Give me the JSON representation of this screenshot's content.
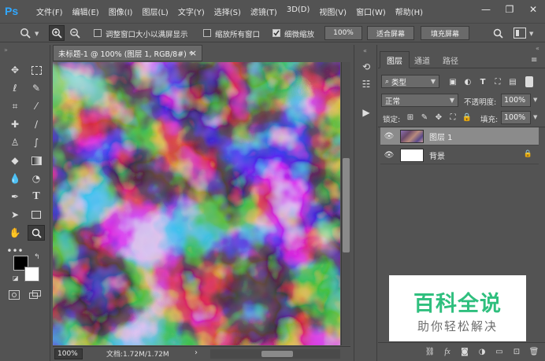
{
  "app": {
    "logo": "Ps"
  },
  "menu": [
    "文件(F)",
    "编辑(E)",
    "图像(I)",
    "图层(L)",
    "文字(Y)",
    "选择(S)",
    "滤镜(T)",
    "3D(D)",
    "视图(V)",
    "窗口(W)",
    "帮助(H)"
  ],
  "window_controls": {
    "minimize": "—",
    "restore": "❐",
    "close": "✕"
  },
  "options": {
    "resize_windows": {
      "label": "调整窗口大小以满屏显示",
      "checked": false
    },
    "zoom_all_windows": {
      "label": "缩放所有窗口",
      "checked": false
    },
    "scrubby_zoom": {
      "label": "细微缩放",
      "checked": true
    },
    "zoom_value": "100%",
    "fit_screen": "适合屏幕",
    "fill_screen": "填充屏幕"
  },
  "document": {
    "tab_title": "未标题-1 @ 100% (图层 1, RGB/8#) *",
    "tab_close": "×",
    "zoom": "100%",
    "info": "文档:1.72M/1.72M",
    "info_arrow": "›"
  },
  "layers_panel": {
    "tabs": [
      "图层",
      "通道",
      "路径"
    ],
    "filter_kind": "类型",
    "blend_mode": "正常",
    "opacity_label": "不透明度:",
    "opacity": "100%",
    "lock_label": "锁定:",
    "fill_label": "填充:",
    "fill": "100%",
    "layers": [
      {
        "name": "图层 1",
        "selected": true,
        "locked": false
      },
      {
        "name": "背景",
        "selected": false,
        "locked": true
      }
    ]
  },
  "watermark": {
    "title": "百科全说",
    "subtitle": "助你轻松解决"
  },
  "colors": {
    "accent": "#31a8ff",
    "panel_bg": "#535353",
    "watermark_green": "#2fbf7e",
    "selected_layer": "#8b8b8b"
  }
}
